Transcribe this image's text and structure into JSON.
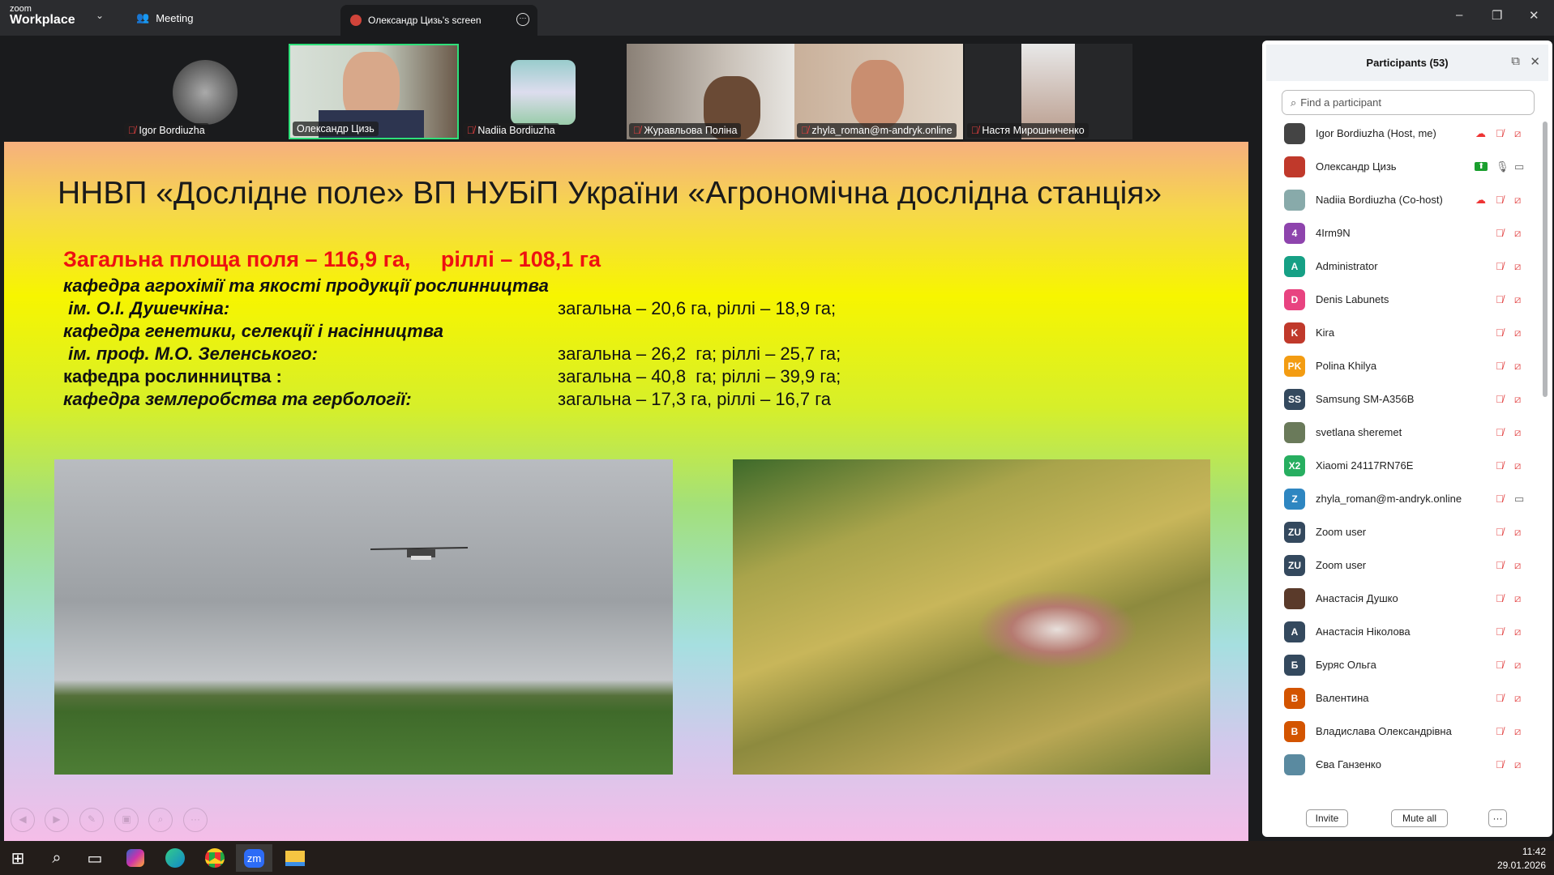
{
  "app": {
    "logo_top": "zoom",
    "logo_bottom": "Workplace",
    "meeting_label": "Meeting",
    "screen_tab": "Олександр Цизь's screen"
  },
  "videos": [
    {
      "name": "Igor Bordiuzha",
      "muted": true
    },
    {
      "name": "Олександр Цизь",
      "muted": false,
      "active": true
    },
    {
      "name": "Nadiia Bordiuzha",
      "muted": true
    },
    {
      "name": "Журавльова Поліна",
      "muted": true
    },
    {
      "name": "zhyla_roman@m-andryk.online",
      "muted": true
    },
    {
      "name": "Настя Мирошниченко",
      "muted": true
    }
  ],
  "slide": {
    "title": "ННВП «Дослідне поле» ВП НУБіП України «Агрономічна дослідна станція»",
    "total": "Загальна площа поля – 116,9 га,     ріллі – 108,1 га",
    "rows": [
      {
        "left": "кафедра агрохімії та якості продукції рослинництва",
        "right": ""
      },
      {
        "left": " ім. О.І. Душечкіна:",
        "right": "загальна – 20,6 га, ріллі – 18,9 га;"
      },
      {
        "left": "кафедра генетики, селекції і насінництва",
        "right": ""
      },
      {
        "left": " ім. проф. М.О. Зеленського:",
        "right": "загальна – 26,2  га; ріллі – 25,7 га;"
      },
      {
        "left": "кафедра рослинництва :",
        "right": "загальна – 40,8  га; ріллі – 39,9 га;"
      },
      {
        "left": "кафедра землеробства та гербології:",
        "right": "загальна – 17,3 га, ріллі – 16,7 га"
      }
    ]
  },
  "participants": {
    "title": "Participants (53)",
    "search_placeholder": "Find a participant",
    "list": [
      {
        "name": "Igor Bordiuzha (Host, me)",
        "initials": "",
        "color": "#444",
        "rec": true,
        "mic": "muted",
        "cam": "off"
      },
      {
        "name": "Олександр Цизь",
        "initials": "",
        "color": "#c0392b",
        "share": true,
        "mic": "on",
        "cam": "on"
      },
      {
        "name": "Nadiia Bordiuzha (Co-host)",
        "initials": "",
        "color": "#8aa",
        "rec": true,
        "mic": "muted",
        "cam": "off"
      },
      {
        "name": "4Irm9N",
        "initials": "4",
        "color": "#8e44ad",
        "mic": "muted",
        "cam": "off"
      },
      {
        "name": "Administrator",
        "initials": "A",
        "color": "#16a085",
        "mic": "muted",
        "cam": "off"
      },
      {
        "name": "Denis Labunets",
        "initials": "D",
        "color": "#e84380",
        "mic": "muted",
        "cam": "off"
      },
      {
        "name": "Kira",
        "initials": "K",
        "color": "#c0392b",
        "mic": "muted",
        "cam": "off"
      },
      {
        "name": "Polina Khilya",
        "initials": "PK",
        "color": "#f39c12",
        "mic": "muted",
        "cam": "off"
      },
      {
        "name": "Samsung SM-A356B",
        "initials": "SS",
        "color": "#34495e",
        "mic": "muted",
        "cam": "off"
      },
      {
        "name": "svetlana sheremet",
        "initials": "",
        "color": "#6a7a5a",
        "mic": "muted",
        "cam": "off"
      },
      {
        "name": "Xiaomi 24117RN76E",
        "initials": "X2",
        "color": "#27ae60",
        "mic": "muted",
        "cam": "off"
      },
      {
        "name": "zhyla_roman@m-andryk.online",
        "initials": "Z",
        "color": "#2e86c1",
        "mic": "muted",
        "cam": "on"
      },
      {
        "name": "Zoom user",
        "initials": "ZU",
        "color": "#34495e",
        "mic": "muted",
        "cam": "off"
      },
      {
        "name": "Zoom user",
        "initials": "ZU",
        "color": "#34495e",
        "mic": "muted",
        "cam": "off"
      },
      {
        "name": "Анастасія Душко",
        "initials": "",
        "color": "#5a3a2a",
        "mic": "muted",
        "cam": "off"
      },
      {
        "name": "Анастасія Ніколова",
        "initials": "A",
        "color": "#34495e",
        "mic": "muted",
        "cam": "off"
      },
      {
        "name": "Буряс Ольга",
        "initials": "Б",
        "color": "#34495e",
        "mic": "muted",
        "cam": "off"
      },
      {
        "name": "Валентина",
        "initials": "В",
        "color": "#d35400",
        "mic": "muted",
        "cam": "off"
      },
      {
        "name": "Владислава Олександрівна",
        "initials": "В",
        "color": "#d35400",
        "mic": "muted",
        "cam": "off"
      },
      {
        "name": "Єва Ганзенко",
        "initials": "",
        "color": "#5a8aa0",
        "mic": "muted",
        "cam": "off"
      }
    ],
    "invite": "Invite",
    "mute_all": "Mute all",
    "more": "···"
  },
  "taskbar": {
    "time": "11:42",
    "date": "29.01.2026",
    "zoom_label": "zm"
  }
}
